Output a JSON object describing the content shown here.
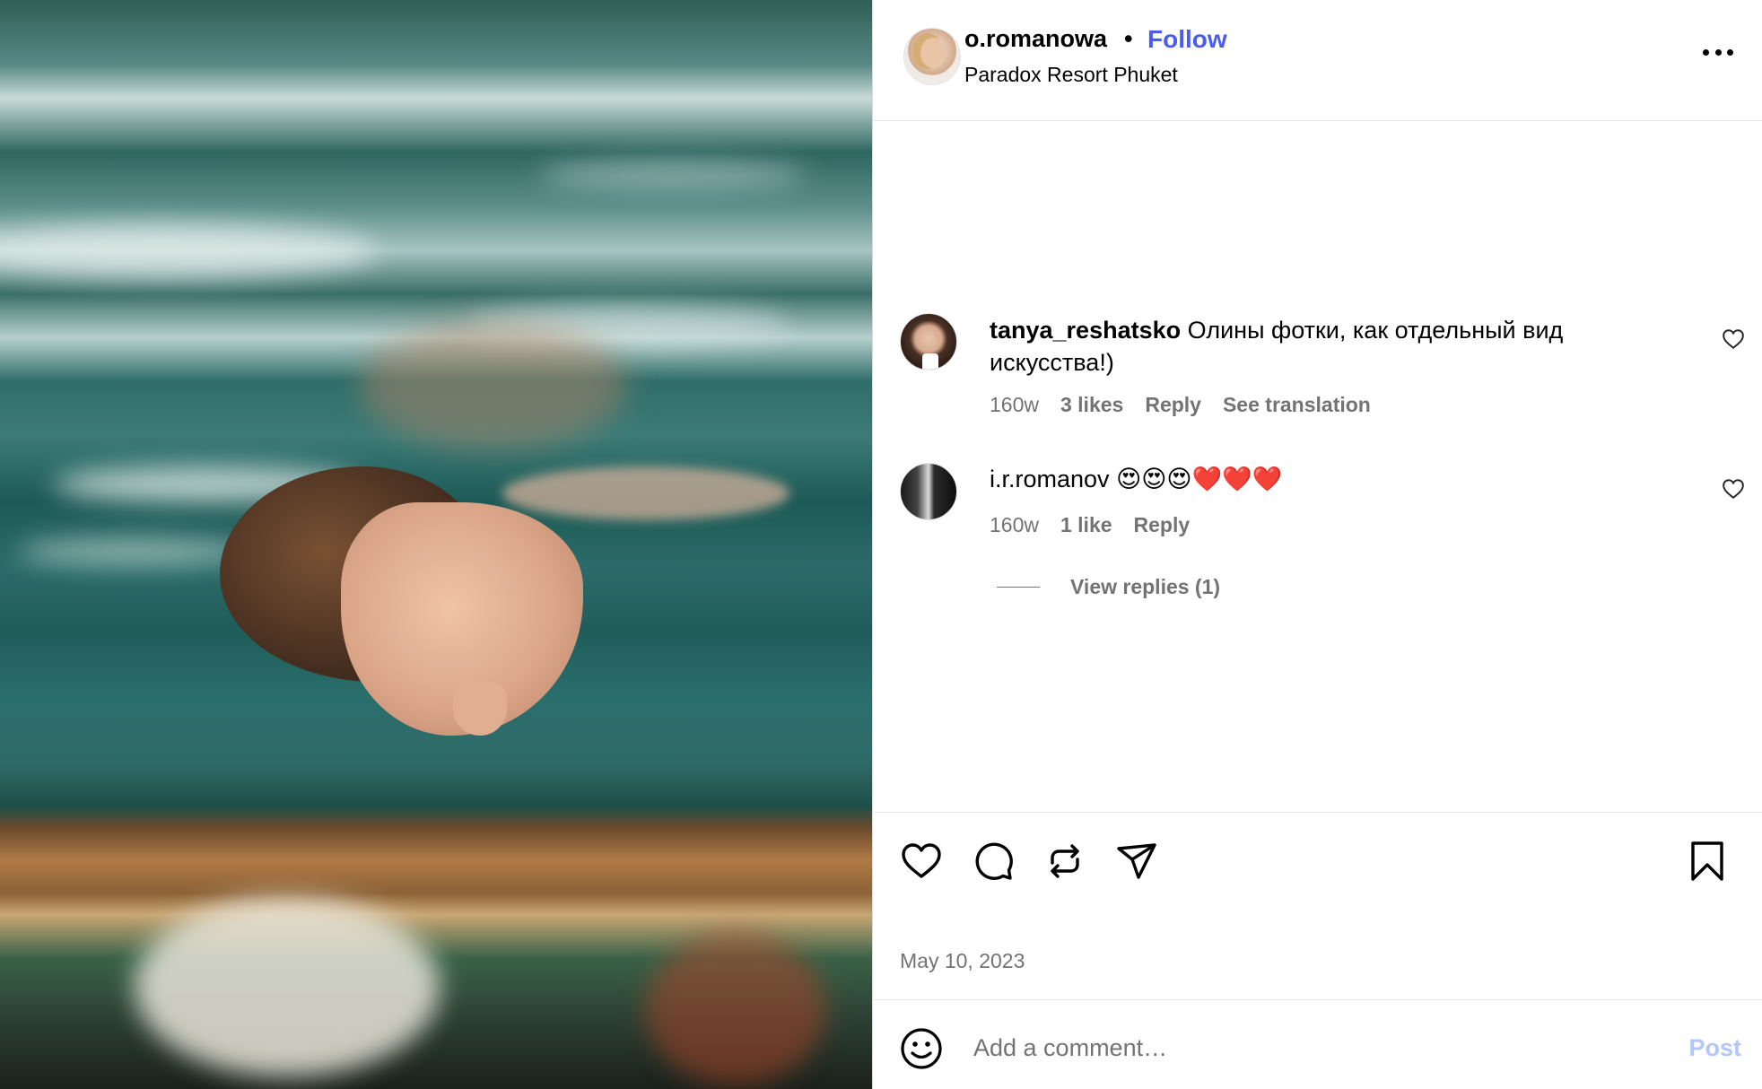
{
  "post": {
    "username": "o.romanowa",
    "separator": "•",
    "follow_label": "Follow",
    "location": "Paradox Resort Phuket",
    "date": "May 10, 2023"
  },
  "comments": [
    {
      "username": "tanya_reshatsko",
      "text": "Олины фотки, как отдельный вид искусства!)",
      "time": "160w",
      "likes": "3 likes",
      "reply_label": "Reply",
      "translate_label": "See translation"
    },
    {
      "username": "i.r.romanov",
      "text": "😍😍😍❤️❤️❤️",
      "time": "160w",
      "likes": "1 like",
      "reply_label": "Reply",
      "view_replies": "View replies (1)"
    }
  ],
  "composer": {
    "placeholder": "Add a comment…",
    "post_label": "Post"
  },
  "colors": {
    "follow": "#4a5cf0",
    "muted": "#737373",
    "post_disabled": "#b2c7fa"
  }
}
